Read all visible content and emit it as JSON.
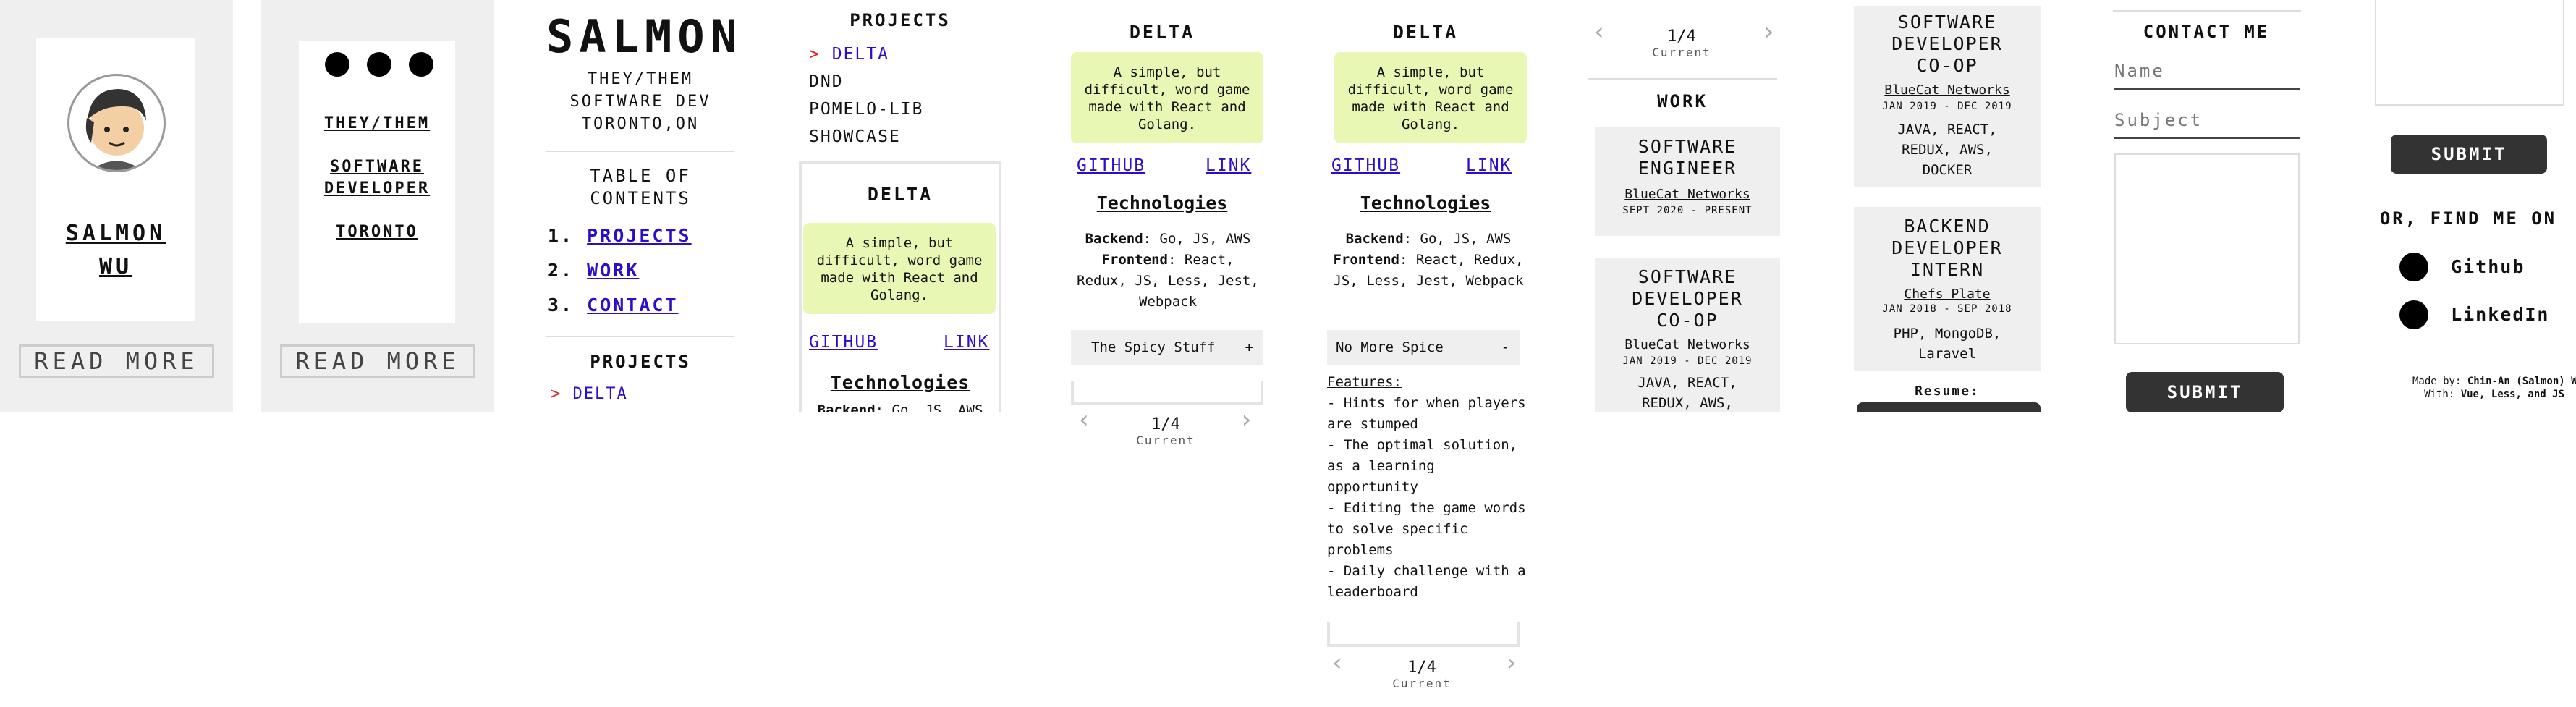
{
  "panel1": {
    "name_line1": "SALMON",
    "name_line2": "WU",
    "read_more": "READ MORE"
  },
  "panel2": {
    "pronouns": "THEY/THEM",
    "role_line1": "SOFTWARE",
    "role_line2": "DEVELOPER",
    "location": "TORONTO",
    "read_more": "READ MORE"
  },
  "panel3": {
    "title": "SALMON",
    "sub1": "THEY/THEM",
    "sub2": "SOFTWARE DEV",
    "sub3": "TORONTO,ON",
    "toc_line1": "TABLE OF",
    "toc_line2": "CONTENTS",
    "toc": [
      {
        "num": "1.",
        "label": "PROJECTS"
      },
      {
        "num": "2.",
        "label": "WORK"
      },
      {
        "num": "3.",
        "label": "CONTACT"
      }
    ],
    "projects_heading": "PROJECTS",
    "first_project": "DELTA"
  },
  "panel4": {
    "heading": "PROJECTS",
    "items": [
      "DELTA",
      "DND",
      "POMELO-LIB",
      "SHOWCASE"
    ],
    "card_title": "DELTA",
    "card_desc": "A simple, but difficult, word game made with React and Golang.",
    "github": "GITHUB",
    "link": "LINK",
    "tech_heading": "Technologies",
    "backend_label": "Backend",
    "backend_value": ": Go, JS, AWS"
  },
  "panel5": {
    "title": "DELTA",
    "desc": "A simple, but difficult, word game made with React and Golang.",
    "github": "GITHUB",
    "link": "LINK",
    "tech_heading": "Technologies",
    "backend_label": "Backend",
    "backend_value": ": Go, JS, AWS",
    "frontend_label": "Frontend",
    "frontend_value": ": React, Redux, JS, Less, Jest, Webpack",
    "accordion_label": "The Spicy Stuff",
    "accordion_icon": "+",
    "pager": "1/4",
    "pager_sub": "Current"
  },
  "panel6": {
    "title": "DELTA",
    "desc": "A simple, but difficult, word game made with React and Golang.",
    "github": "GITHUB",
    "link": "LINK",
    "tech_heading": "Technologies",
    "backend_label": "Backend",
    "backend_value": ": Go, JS, AWS",
    "frontend_label": "Frontend",
    "frontend_value": ": React, Redux, JS, Less, Jest, Webpack",
    "accordion_label": "No More Spice",
    "accordion_icon": "-",
    "features_label": "Features:",
    "features": [
      "- Hints for when players are stumped",
      "- The optimal solution, as a learning opportunity",
      "- Editing the game words to solve specific problems",
      "- Daily challenge with a leaderboard"
    ],
    "pager": "1/4",
    "pager_sub": "Current"
  },
  "panel7": {
    "pager": "1/4",
    "pager_sub": "Current",
    "work_heading": "WORK",
    "jobs": [
      {
        "title": "SOFTWARE ENGINEER",
        "company": "BlueCat Networks",
        "dates": "SEPT 2020 - PRESENT"
      },
      {
        "title": "SOFTWARE DEVELOPER CO-OP",
        "company": "BlueCat Networks",
        "dates": "JAN 2019 - DEC 2019",
        "skills": "JAVA, REACT, REDUX, AWS,"
      }
    ]
  },
  "panel8": {
    "job1_title": "SOFTWARE DEVELOPER CO-OP",
    "job1_company": "BlueCat Networks",
    "job1_dates": "JAN 2019 - DEC 2019",
    "job1_skills": "JAVA, REACT, REDUX, AWS, DOCKER",
    "job2_title": "BACKEND DEVELOPER INTERN",
    "job2_company": "Chefs Plate",
    "job2_dates": "JAN 2018 - SEP 2018",
    "job2_skills": "PHP, MongoDB, Laravel",
    "resume_label": "Resume:"
  },
  "panel9": {
    "heading": "CONTACT ME",
    "name_placeholder": "Name",
    "subject_placeholder": "Subject",
    "submit": "SUBMIT"
  },
  "panel10": {
    "submit": "SUBMIT",
    "find_me": "OR, FIND ME ON",
    "links": [
      "Github",
      "LinkedIn"
    ],
    "made_by_label": "Made by: ",
    "made_by_name": "Chin-An (Salmon) Wu",
    "with_label": "With: ",
    "with_value": "Vue, Less, and JS"
  }
}
